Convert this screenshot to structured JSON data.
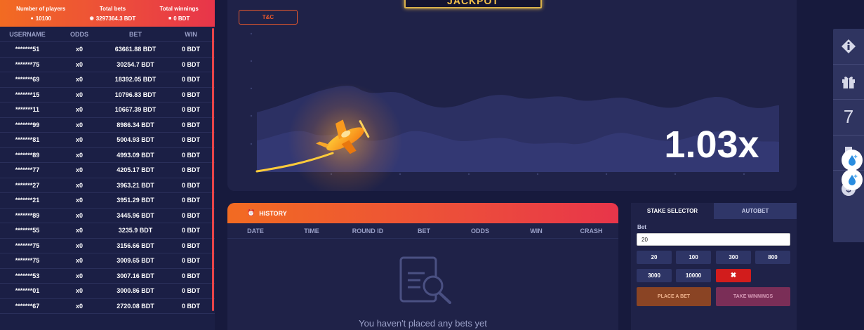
{
  "stats": {
    "players_label": "Number of players",
    "players_value": "10100",
    "bets_label": "Total bets",
    "bets_value": "3297364.3 BDT",
    "winnings_label": "Total winnings",
    "winnings_value": "0 BDT"
  },
  "players_table": {
    "headers": [
      "USERNAME",
      "ODDS",
      "BET",
      "WIN"
    ],
    "rows": [
      [
        "*******51",
        "x0",
        "63661.88 BDT",
        "0 BDT"
      ],
      [
        "*******75",
        "x0",
        "30254.7 BDT",
        "0 BDT"
      ],
      [
        "*******69",
        "x0",
        "18392.05 BDT",
        "0 BDT"
      ],
      [
        "*******15",
        "x0",
        "10796.83 BDT",
        "0 BDT"
      ],
      [
        "*******11",
        "x0",
        "10667.39 BDT",
        "0 BDT"
      ],
      [
        "*******99",
        "x0",
        "8986.34 BDT",
        "0 BDT"
      ],
      [
        "*******81",
        "x0",
        "5004.93 BDT",
        "0 BDT"
      ],
      [
        "*******89",
        "x0",
        "4993.09 BDT",
        "0 BDT"
      ],
      [
        "*******77",
        "x0",
        "4205.17 BDT",
        "0 BDT"
      ],
      [
        "*******27",
        "x0",
        "3963.21 BDT",
        "0 BDT"
      ],
      [
        "*******21",
        "x0",
        "3951.29 BDT",
        "0 BDT"
      ],
      [
        "*******89",
        "x0",
        "3445.96 BDT",
        "0 BDT"
      ],
      [
        "*******55",
        "x0",
        "3235.9 BDT",
        "0 BDT"
      ],
      [
        "*******75",
        "x0",
        "3156.66 BDT",
        "0 BDT"
      ],
      [
        "*******75",
        "x0",
        "3009.65 BDT",
        "0 BDT"
      ],
      [
        "*******53",
        "x0",
        "3007.16 BDT",
        "0 BDT"
      ],
      [
        "*******01",
        "x0",
        "3000.86 BDT",
        "0 BDT"
      ],
      [
        "*******67",
        "x0",
        "2720.08 BDT",
        "0 BDT"
      ]
    ]
  },
  "game": {
    "jackpot_label": "JACKPOT",
    "tc_label": "T&C",
    "multiplier": "1.03x"
  },
  "history": {
    "title": "HISTORY",
    "headers": [
      "DATE",
      "TIME",
      "ROUND ID",
      "BET",
      "ODDS",
      "WIN",
      "CRASH"
    ],
    "empty_message": "You haven't placed any bets yet"
  },
  "bet_panel": {
    "tabs": [
      "STAKE SELECTOR",
      "AUTOBET"
    ],
    "active_tab": "STAKE SELECTOR",
    "bet_label": "Bet",
    "bet_value": "20",
    "amounts": [
      "20",
      "100",
      "300",
      "800",
      "3000",
      "10000"
    ],
    "clear_label": "✖",
    "place_bet_label": "PLACE A BET",
    "take_winnings_label": "TAKE WINNINGS"
  },
  "side_rail": {
    "icons": [
      "info-icon",
      "gift-icon",
      "seven-icon",
      "trophy-icon",
      "dollar-icon"
    ],
    "seven_label": "7"
  },
  "colors": {
    "background": "#171a3d",
    "panel": "#1f2248",
    "accent_orange": "#f26b22",
    "accent_red": "#e8354a",
    "place_bet": "#8a4424",
    "take_winnings": "#7a2e57",
    "clear": "#d21c1c"
  }
}
